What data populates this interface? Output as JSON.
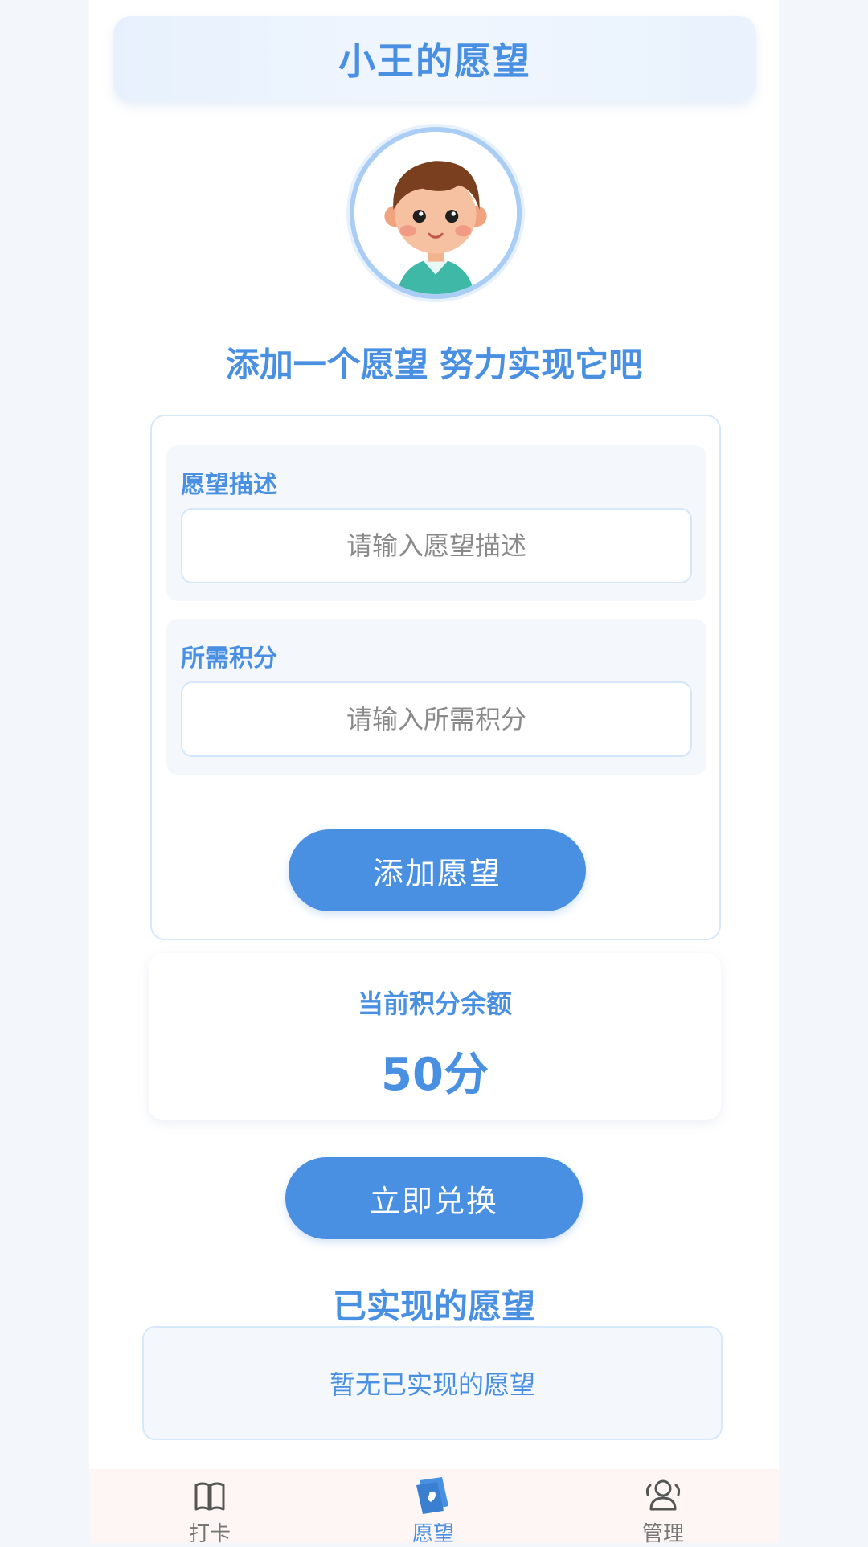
{
  "header": {
    "title": "小王的愿望"
  },
  "slogan": "添加一个愿望 努力实现它吧",
  "form": {
    "description": {
      "label": "愿望描述",
      "placeholder": "请输入愿望描述",
      "value": ""
    },
    "points": {
      "label": "所需积分",
      "placeholder": "请输入所需积分",
      "value": ""
    },
    "submit_label": "添加愿望"
  },
  "balance": {
    "label": "当前积分余额",
    "value": "50分"
  },
  "redeem_label": "立即兑换",
  "fulfilled": {
    "title": "已实现的愿望",
    "empty_text": "暂无已实现的愿望"
  },
  "tabs": [
    {
      "label": "打卡",
      "icon": "book-icon",
      "active": false
    },
    {
      "label": "愿望",
      "icon": "wish-card-icon",
      "active": true
    },
    {
      "label": "管理",
      "icon": "user-manage-icon",
      "active": false
    }
  ],
  "colors": {
    "accent": "#4a90e2",
    "card_bg": "#f4f8fd",
    "border": "#d6e8fb",
    "tabbar_bg": "#fdf6f4"
  }
}
